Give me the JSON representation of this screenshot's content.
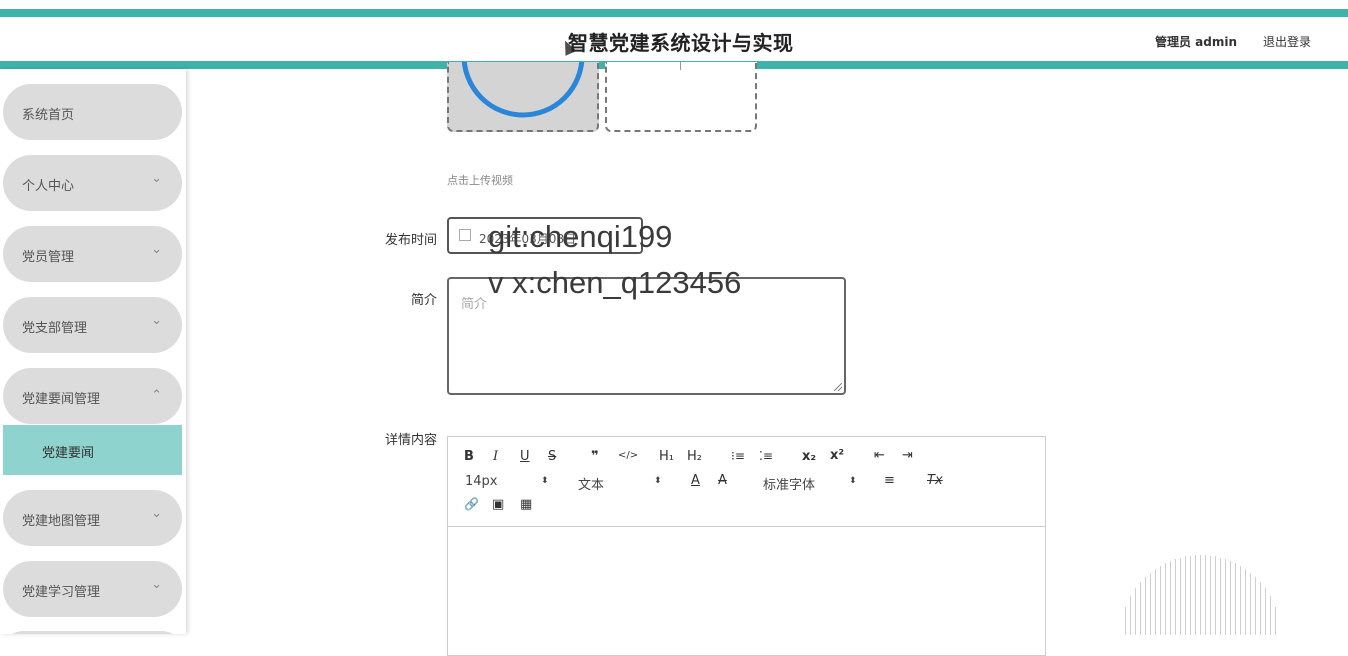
{
  "header": {
    "title": "智慧党建系统设计与实现",
    "user": "管理员 admin",
    "logout": "退出登录"
  },
  "sidebar": {
    "items": [
      {
        "label": "系统首页",
        "chevron": ""
      },
      {
        "label": "个人中心",
        "chevron": "⌄"
      },
      {
        "label": "党员管理",
        "chevron": "⌄"
      },
      {
        "label": "党支部管理",
        "chevron": "⌄"
      },
      {
        "label": "党建要闻管理",
        "chevron": "⌃"
      },
      {
        "label": "党建地图管理",
        "chevron": "⌄"
      },
      {
        "label": "党建学习管理",
        "chevron": "⌄"
      }
    ],
    "submenu": {
      "label": "党建要闻"
    }
  },
  "form": {
    "upload_hint": "点击上传视频",
    "publish_time_label": "发布时间",
    "publish_time_value": "2023年03月08日",
    "summary_label": "简介",
    "summary_placeholder": "简介",
    "detail_label": "详情内容"
  },
  "watermark": {
    "line1": "git:chenqi199",
    "line2": "v x:chen_q123456"
  },
  "editor": {
    "bold": "B",
    "italic": "I",
    "underline": "U",
    "strike": "S",
    "quote": "❞",
    "code": "</>",
    "h1": "H₁",
    "h2": "H₂",
    "ordered_list": "⁝≡",
    "bullet_list": "⁚≡",
    "subscript": "x₂",
    "superscript": "x²",
    "outdent": "⇤",
    "indent": "⇥",
    "size_value": "14px",
    "header_value": "文本",
    "font_color": "A",
    "bg_color": "A",
    "font_family_value": "标准字体",
    "align": "≡",
    "clear": "Tx",
    "link": "🔗",
    "image": "▣",
    "video": "▦"
  },
  "colors": {
    "accent": "#3fb3aa",
    "submenu_bg": "#8fd3cf",
    "menu_bg": "#dcdcdc",
    "upload_circle": "#2a86d8"
  }
}
